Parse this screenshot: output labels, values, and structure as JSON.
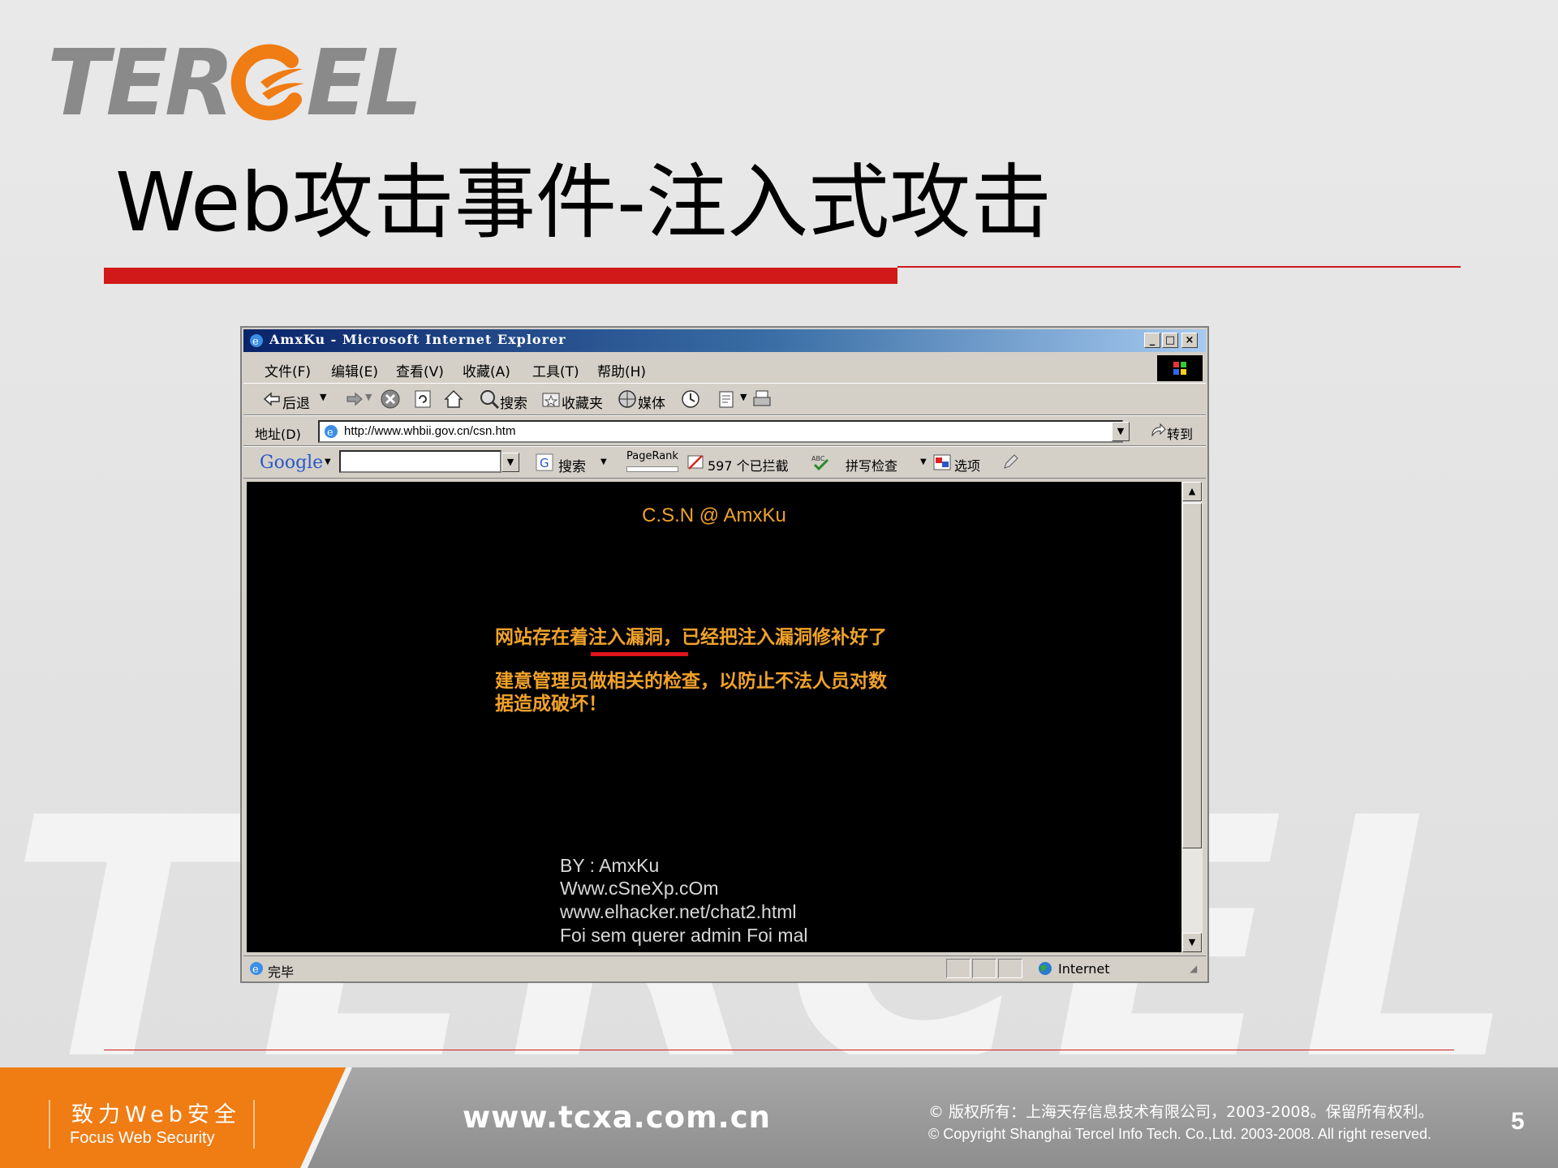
{
  "brand": {
    "logo_text_left": "TER",
    "logo_text_right": "EL",
    "orange": "#f07c14",
    "red": "#d11919"
  },
  "slide": {
    "title": "Web攻击事件-注入式攻击",
    "page_number": "5"
  },
  "browser": {
    "window_title": "AmxKu - Microsoft Internet Explorer",
    "menu": [
      "文件(F)",
      "编辑(E)",
      "查看(V)",
      "收藏(A)",
      "工具(T)",
      "帮助(H)"
    ],
    "toolbar": {
      "back": "后退",
      "search": "搜索",
      "favorites": "收藏夹",
      "media": "媒体"
    },
    "address_label": "地址(D)",
    "address_url": "http://www.whbii.gov.cn/csn.htm",
    "go_label": "转到",
    "google_bar": {
      "logo": "Google",
      "search": "搜索",
      "pagerank": "PageRank",
      "blocked": "597 个已拦截",
      "spellcheck": "拼写检查",
      "options": "选项"
    },
    "status_text": "完毕",
    "status_zone": "Internet"
  },
  "defaced_page": {
    "heading": "C.S.N @ AmxKu",
    "message_line1": "网站存在着注入漏洞，已经把注入漏洞修补好了",
    "message_line2": "建意管理员做相关的检查，以防止不法人员对数",
    "message_line3": "据造成破坏！",
    "footer_lines": [
      "BY : AmxKu",
      "Www.cSneXp.cOm",
      "www.elhacker.net/chat2.html",
      "Foi sem querer admin Foi mal"
    ]
  },
  "footer": {
    "slogan_cn": "致力Web安全",
    "slogan_en": "Focus Web Security",
    "website": "www.tcxa.com.cn",
    "copyright_cn": "© 版权所有：上海天存信息技术有限公司，2003-2008。保留所有权利。",
    "copyright_en": "© Copyright Shanghai Tercel Info Tech. Co.,Ltd. 2003-2008. All right reserved."
  }
}
